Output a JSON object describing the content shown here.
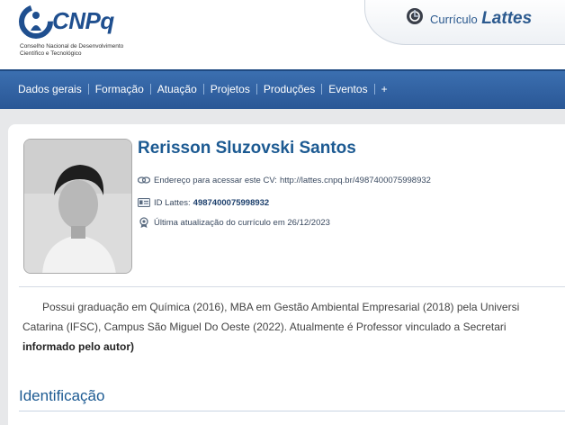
{
  "header": {
    "logo_word": "CNPq",
    "logo_sub_line1": "Conselho Nacional de Desenvolvimento",
    "logo_sub_line2": "Científico e Tecnológico",
    "lattes_prefix": "Currículo",
    "lattes_name": "Lattes"
  },
  "nav": {
    "items": [
      "Dados gerais",
      "Formação",
      "Atuação",
      "Projetos",
      "Produções",
      "Eventos",
      "+"
    ]
  },
  "profile": {
    "name": "Rerisson Sluzovski Santos",
    "cv_address_label": "Endereço para acessar este CV:",
    "cv_address_url": "http://lattes.cnpq.br/4987400075998932",
    "id_label": "ID Lattes:",
    "id_value": "4987400075998932",
    "last_update": "Última atualização do currículo em 26/12/2023"
  },
  "resume": {
    "line1": "Possui graduação em Química (2016), MBA em Gestão Ambiental Empresarial (2018) pela Universi",
    "line2": "Catarina (IFSC), Campus São Miguel Do Oeste (2022). Atualmente é Professor vinculado a Secretari",
    "line3": "informado pelo autor)"
  },
  "sections": {
    "identificacao": "Identificação"
  },
  "colors": {
    "brand_blue": "#1c5a92",
    "nav_blue": "#2f62a3",
    "background": "#e7e8ea"
  }
}
